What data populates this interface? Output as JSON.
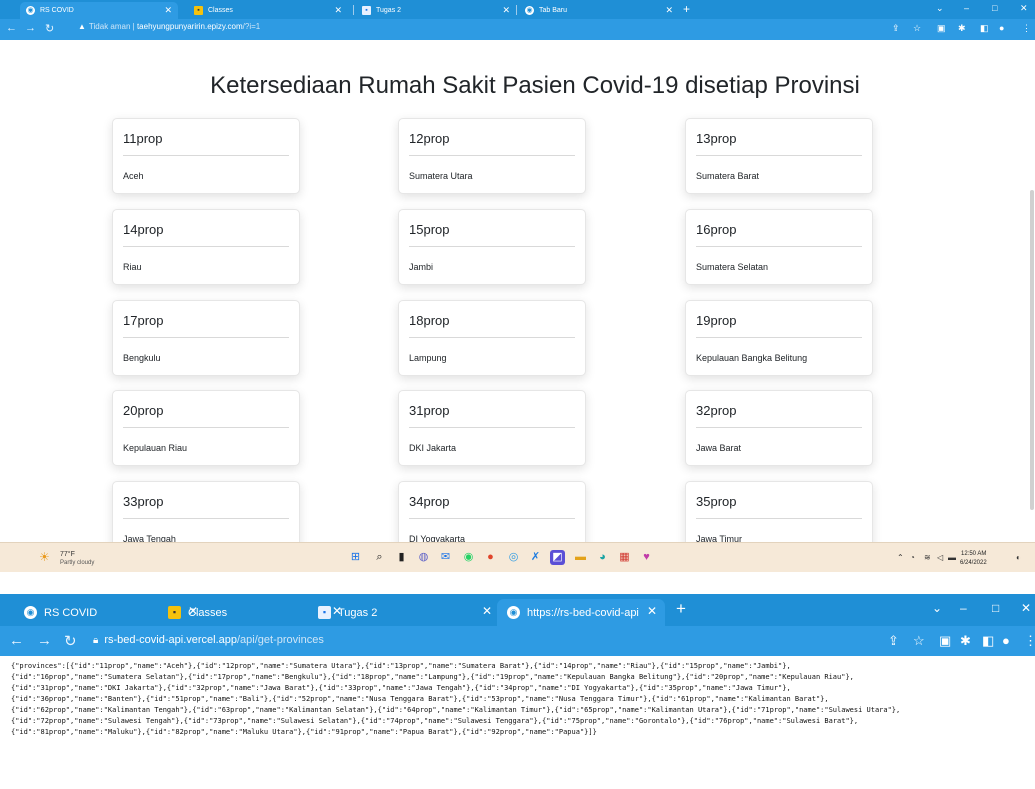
{
  "browser_top": {
    "tabs": [
      {
        "label": "RS COVID",
        "icon": "globe-icon"
      },
      {
        "label": "Classes",
        "icon": "classroom-icon"
      },
      {
        "label": "Tugas 2",
        "icon": "docs-icon"
      },
      {
        "label": "Tab Baru",
        "icon": "globe-icon"
      }
    ],
    "security_label": "Tidak aman",
    "url_host": "taehyungpunyaririn.epizy.com",
    "url_path": "/?i=1"
  },
  "page": {
    "title": "Ketersediaan Rumah Sakit Pasien Covid-19 disetiap Provinsi",
    "provinces": [
      {
        "id": "11prop",
        "name": "Aceh"
      },
      {
        "id": "12prop",
        "name": "Sumatera Utara"
      },
      {
        "id": "13prop",
        "name": "Sumatera Barat"
      },
      {
        "id": "14prop",
        "name": "Riau"
      },
      {
        "id": "15prop",
        "name": "Jambi"
      },
      {
        "id": "16prop",
        "name": "Sumatera Selatan"
      },
      {
        "id": "17prop",
        "name": "Bengkulu"
      },
      {
        "id": "18prop",
        "name": "Lampung"
      },
      {
        "id": "19prop",
        "name": "Kepulauan Bangka Belitung"
      },
      {
        "id": "20prop",
        "name": "Kepulauan Riau"
      },
      {
        "id": "31prop",
        "name": "DKI Jakarta"
      },
      {
        "id": "32prop",
        "name": "Jawa Barat"
      },
      {
        "id": "33prop",
        "name": "Jawa Tengah"
      },
      {
        "id": "34prop",
        "name": "DI Yogyakarta"
      },
      {
        "id": "35prop",
        "name": "Jawa Timur"
      }
    ]
  },
  "taskbar": {
    "temperature": "77°F",
    "weather": "Partly cloudy",
    "time": "12:50 AM",
    "date": "6/24/2022"
  },
  "browser_bottom": {
    "tabs": [
      {
        "label": "RS COVID",
        "icon": "globe-icon"
      },
      {
        "label": "Classes",
        "icon": "classroom-icon"
      },
      {
        "label": "Tugas 2",
        "icon": "docs-icon"
      },
      {
        "label": "https://rs-bed-covid-api.vercel.a",
        "icon": "globe-icon"
      }
    ],
    "url_host": "rs-bed-covid-api.vercel.app",
    "url_path": "/api/get-provinces",
    "json_lines": [
      "{\"provinces\":[{\"id\":\"11prop\",\"name\":\"Aceh\"},{\"id\":\"12prop\",\"name\":\"Sumatera Utara\"},{\"id\":\"13prop\",\"name\":\"Sumatera Barat\"},{\"id\":\"14prop\",\"name\":\"Riau\"},{\"id\":\"15prop\",\"name\":\"Jambi\"},",
      "{\"id\":\"16prop\",\"name\":\"Sumatera Selatan\"},{\"id\":\"17prop\",\"name\":\"Bengkulu\"},{\"id\":\"18prop\",\"name\":\"Lampung\"},{\"id\":\"19prop\",\"name\":\"Kepulauan Bangka Belitung\"},{\"id\":\"20prop\",\"name\":\"Kepulauan Riau\"},",
      "{\"id\":\"31prop\",\"name\":\"DKI Jakarta\"},{\"id\":\"32prop\",\"name\":\"Jawa Barat\"},{\"id\":\"33prop\",\"name\":\"Jawa Tengah\"},{\"id\":\"34prop\",\"name\":\"DI Yogyakarta\"},{\"id\":\"35prop\",\"name\":\"Jawa Timur\"},",
      "{\"id\":\"36prop\",\"name\":\"Banten\"},{\"id\":\"51prop\",\"name\":\"Bali\"},{\"id\":\"52prop\",\"name\":\"Nusa Tenggara Barat\"},{\"id\":\"53prop\",\"name\":\"Nusa Tenggara Timur\"},{\"id\":\"61prop\",\"name\":\"Kalimantan Barat\"},",
      "{\"id\":\"62prop\",\"name\":\"Kalimantan Tengah\"},{\"id\":\"63prop\",\"name\":\"Kalimantan Selatan\"},{\"id\":\"64prop\",\"name\":\"Kalimantan Timur\"},{\"id\":\"65prop\",\"name\":\"Kalimantan Utara\"},{\"id\":\"71prop\",\"name\":\"Sulawesi Utara\"},",
      "{\"id\":\"72prop\",\"name\":\"Sulawesi Tengah\"},{\"id\":\"73prop\",\"name\":\"Sulawesi Selatan\"},{\"id\":\"74prop\",\"name\":\"Sulawesi Tenggara\"},{\"id\":\"75prop\",\"name\":\"Gorontalo\"},{\"id\":\"76prop\",\"name\":\"Sulawesi Barat\"},",
      "{\"id\":\"81prop\",\"name\":\"Maluku\"},{\"id\":\"82prop\",\"name\":\"Maluku Utara\"},{\"id\":\"91prop\",\"name\":\"Papua Barat\"},{\"id\":\"92prop\",\"name\":\"Papua\"}]}"
    ]
  }
}
